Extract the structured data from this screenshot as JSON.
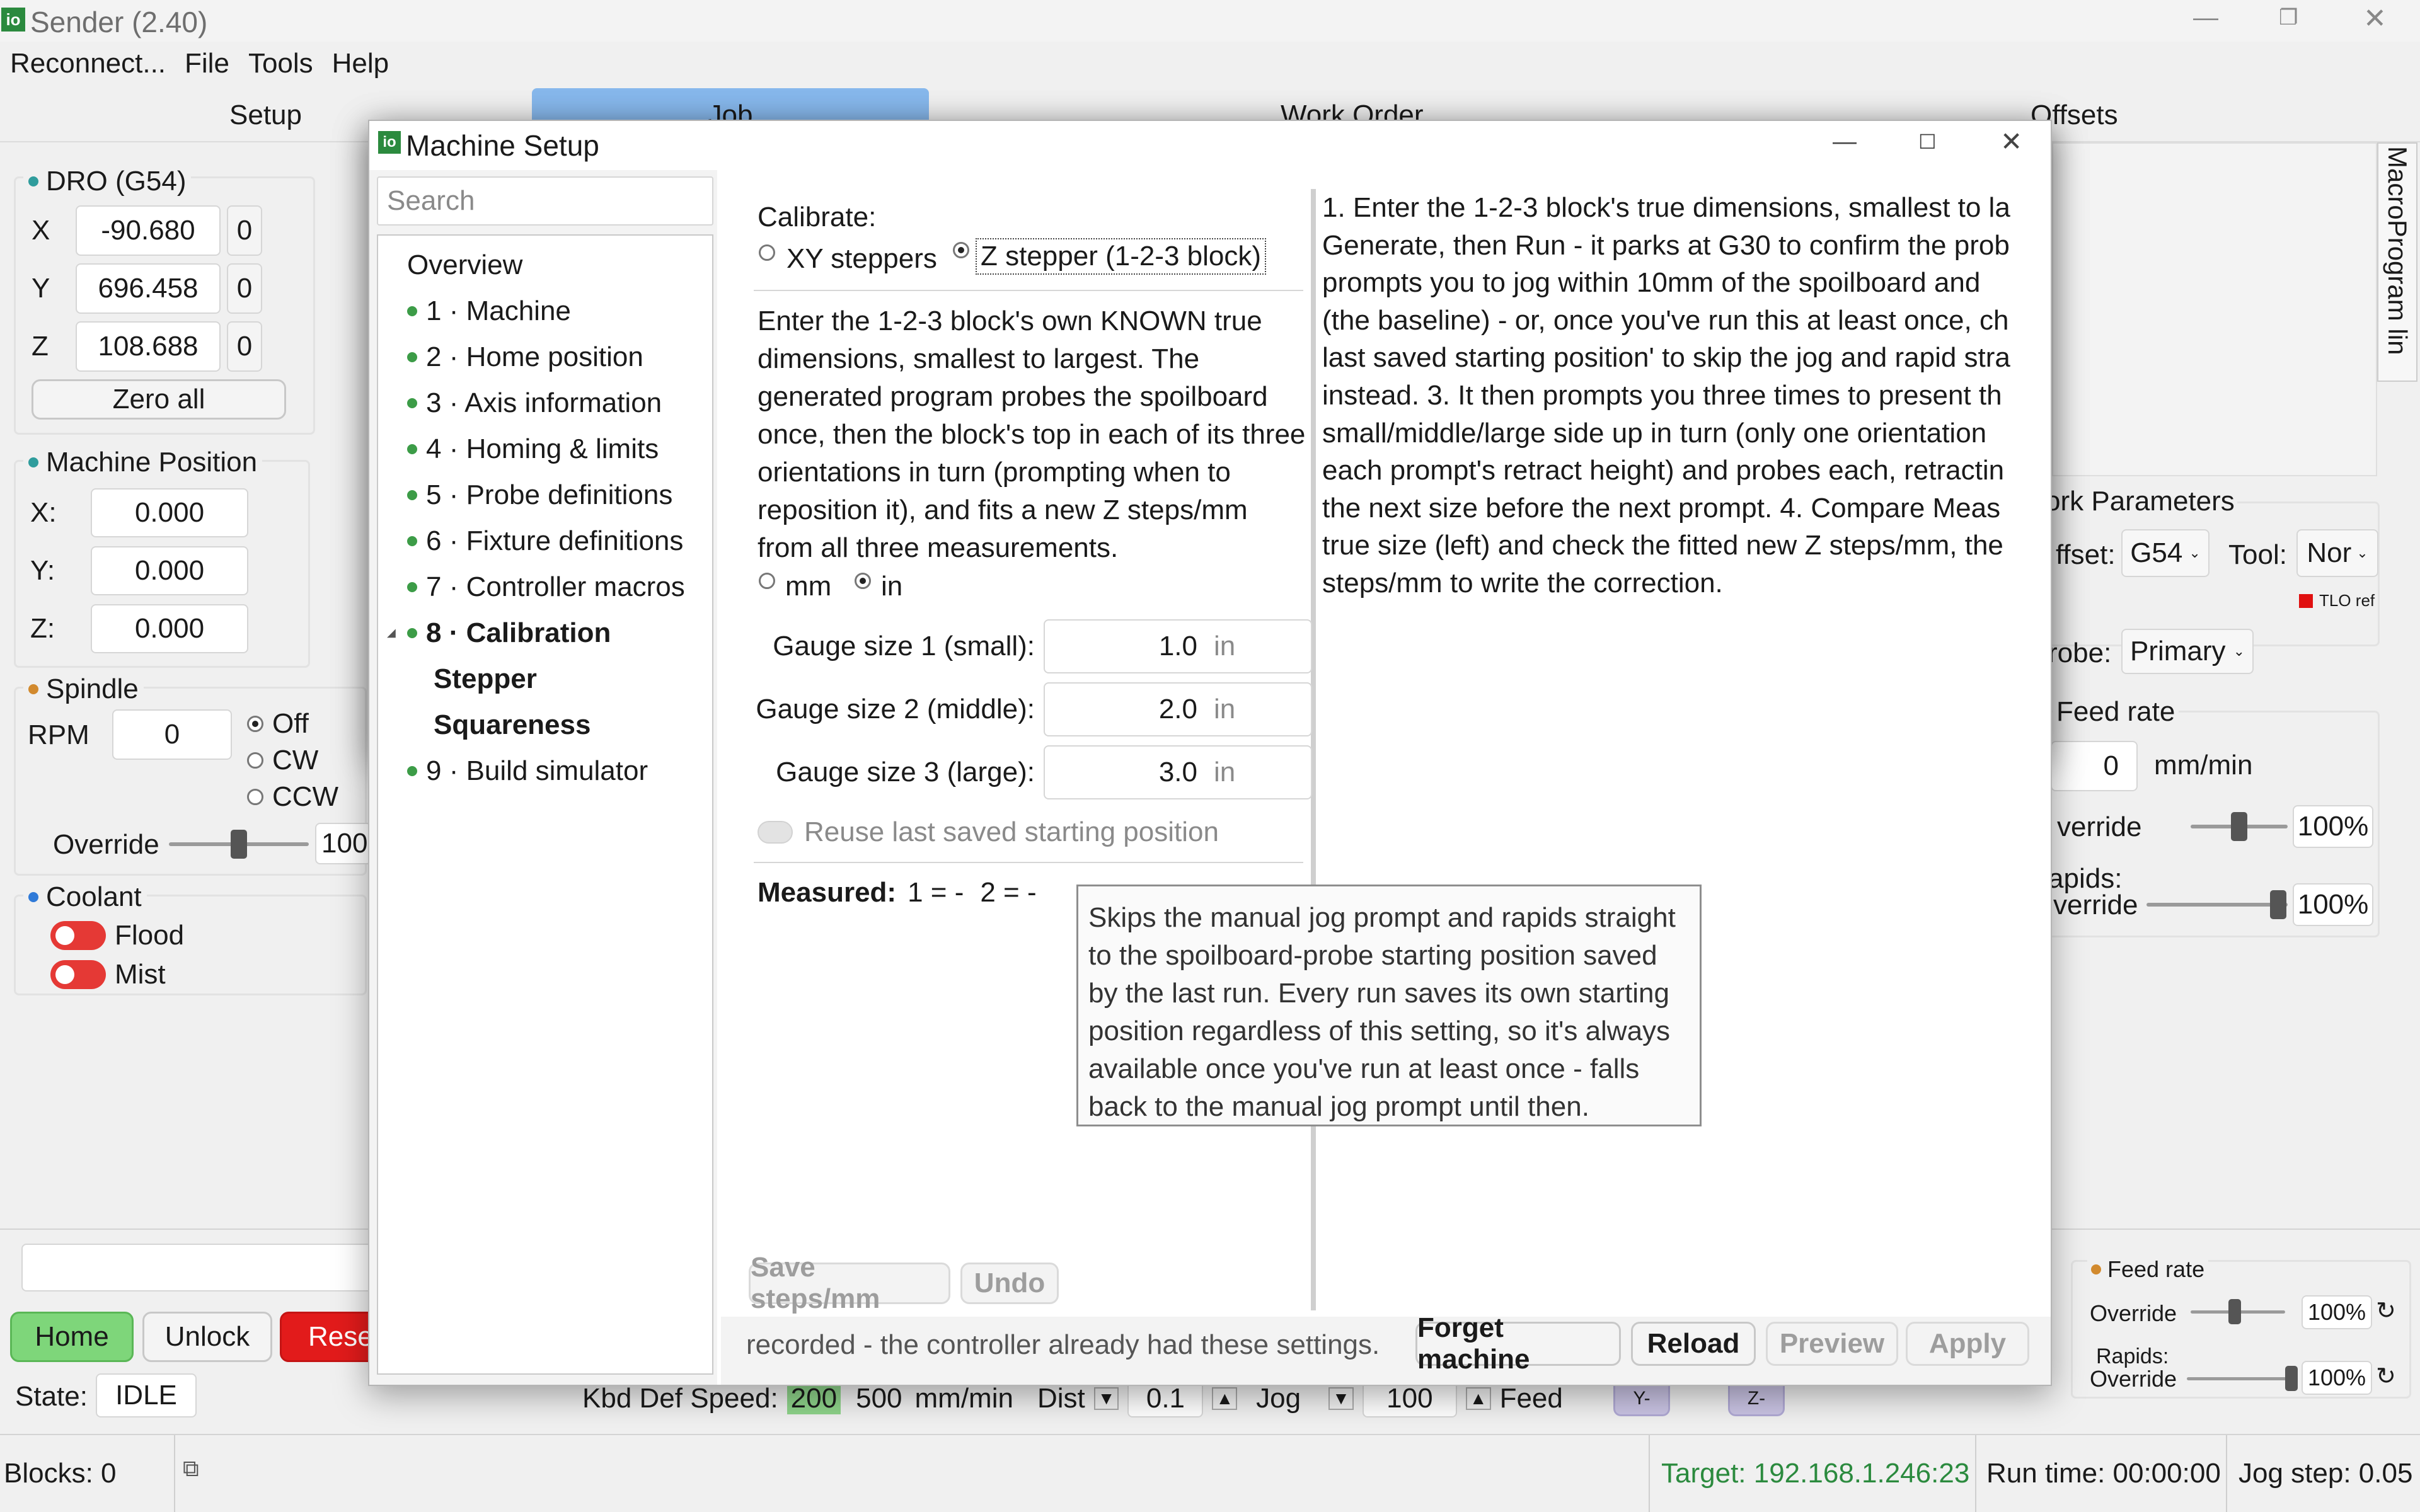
{
  "app": {
    "title": "Sender (2.40)",
    "menu": [
      "Reconnect...",
      "File",
      "Tools",
      "Help"
    ]
  },
  "main_tabs": [
    "Setup",
    "Job",
    "Work Order",
    "Offsets"
  ],
  "side_tab": "MacroProgram lin",
  "dro": {
    "title": "DRO (G54)",
    "axes": [
      {
        "label": "X",
        "value": "-90.680",
        "zero": "0"
      },
      {
        "label": "Y",
        "value": "696.458",
        "zero": "0"
      },
      {
        "label": "Z",
        "value": "108.688",
        "zero": "0"
      }
    ],
    "zero_all": "Zero all"
  },
  "machine_position": {
    "title": "Machine Position",
    "axes": [
      {
        "label": "X:",
        "value": "0.000"
      },
      {
        "label": "Y:",
        "value": "0.000"
      },
      {
        "label": "Z:",
        "value": "0.000"
      }
    ]
  },
  "spindle": {
    "title": "Spindle",
    "rpm_label": "RPM",
    "rpm_value": "0",
    "options": [
      "Off",
      "CW",
      "CCW"
    ],
    "selected": "Off",
    "override_label": "Override",
    "override_value": "100",
    "override_fraction": 0.5
  },
  "coolant": {
    "title": "Coolant",
    "items": [
      "Flood",
      "Mist"
    ]
  },
  "bottom_buttons": {
    "home": "Home",
    "unlock": "Unlock",
    "reset": "Rese"
  },
  "state": {
    "label": "State:",
    "value": "IDLE"
  },
  "kbd": {
    "label": "Kbd Def Speed:",
    "speed1": "200",
    "speed2": "500",
    "unit": "mm/min",
    "dist_label": "Dist",
    "dist_value": "0.1",
    "jog_label": "Jog",
    "jog_value": "100",
    "feed_label": "Feed"
  },
  "jog_buttons": {
    "y_minus": "Y-",
    "z_minus": "Z-"
  },
  "status_bar": {
    "blocks": "Blocks: 0",
    "target": "Target: 192.168.1.246:23",
    "runtime": "Run time: 00:00:00",
    "jogstep": "Jog step: 0.05"
  },
  "right_panel": {
    "work_params": "ork Parameters",
    "offset_label": "ffset:",
    "offset_value": "G54",
    "tool_label": "Tool:",
    "tool_value": "Nor",
    "tlo_ref": "TLO ref",
    "probe_label": "robe:",
    "probe_value": "Primary",
    "feed_rate_title": "Feed rate",
    "feed_value": "0",
    "feed_unit": "mm/min",
    "override_label": "verride",
    "override_value": "100%",
    "override_fraction": 0.5,
    "rapids_label_1": "apids:",
    "rapids_label_2": "verride",
    "rapids_value": "100%",
    "rapids_fraction": 1.0,
    "bottom_feed_title": "Feed rate",
    "bottom_override_label": "Override",
    "bottom_override_value": "100%",
    "bottom_rapids_label_1": "Rapids:",
    "bottom_rapids_label_2": "Override",
    "bottom_rapids_value": "100%"
  },
  "dialog": {
    "title": "Machine Setup",
    "search_placeholder": "Search",
    "tree": [
      {
        "label": "Overview",
        "dot": false,
        "bold": false,
        "expander": false,
        "indent": false
      },
      {
        "label": "1 · Machine",
        "dot": true,
        "bold": false,
        "expander": false,
        "indent": false
      },
      {
        "label": "2 · Home position",
        "dot": true,
        "bold": false,
        "expander": false,
        "indent": false
      },
      {
        "label": "3 · Axis information",
        "dot": true,
        "bold": false,
        "expander": false,
        "indent": false
      },
      {
        "label": "4 · Homing & limits",
        "dot": true,
        "bold": false,
        "expander": false,
        "indent": false
      },
      {
        "label": "5 · Probe definitions",
        "dot": true,
        "bold": false,
        "expander": false,
        "indent": false
      },
      {
        "label": "6 · Fixture definitions",
        "dot": true,
        "bold": false,
        "expander": false,
        "indent": false
      },
      {
        "label": "7 · Controller macros",
        "dot": true,
        "bold": false,
        "expander": false,
        "indent": false
      },
      {
        "label": "8 · Calibration",
        "dot": true,
        "bold": true,
        "expander": true,
        "indent": false
      },
      {
        "label": "Stepper",
        "dot": false,
        "bold": true,
        "expander": false,
        "indent": true
      },
      {
        "label": "Squareness",
        "dot": false,
        "bold": true,
        "expander": false,
        "indent": true
      },
      {
        "label": "9 · Build simulator",
        "dot": true,
        "bold": false,
        "expander": false,
        "indent": false
      }
    ],
    "calibrate_label": "Calibrate:",
    "calibrate_options": [
      "XY steppers",
      "Z stepper (1-2-3 block)"
    ],
    "calibrate_selected": "Z stepper (1-2-3 block)",
    "description": "Enter the 1-2-3 block's own KNOWN true dimensions, smallest to largest. The generated program probes the spoilboard once, then the block's top in each of its three orientations in turn (prompting when to reposition it), and fits a new Z steps/mm from all three measurements.",
    "unit_options": [
      "mm",
      "in"
    ],
    "unit_selected": "in",
    "gauges": [
      {
        "label": "Gauge size 1 (small):",
        "value": "1.0",
        "unit": "in"
      },
      {
        "label": "Gauge size 2 (middle):",
        "value": "2.0",
        "unit": "in"
      },
      {
        "label": "Gauge size 3 (large):",
        "value": "3.0",
        "unit": "in"
      }
    ],
    "reuse_label": "Reuse last saved starting position",
    "measured_label": "Measured:",
    "measured_1": "1 = -",
    "measured_2": "2 = -",
    "tooltip": "Skips the manual jog prompt and rapids straight to the spoilboard-probe starting position saved by the last run. Every run saves its own starting position regardless of this setting, so it's always available once you've run at least once - falls back to the manual jog prompt until then.",
    "instructions_lines": [
      "1. Enter the 1-2-3 block's true dimensions, smallest to la",
      "Generate, then Run - it parks at G30 to confirm the prob",
      "prompts you to jog within 10mm of the spoilboard and",
      "(the baseline) - or, once you've run this at least once, ch",
      "last saved starting position' to skip the jog and rapid stra",
      "instead.  3. It then prompts you three times to present th",
      "small/middle/large side up in turn (only one orientation",
      "each prompt's retract height) and probes each, retractin",
      "the next size before the next prompt.  4. Compare Meas",
      "true size (left) and check the fitted new Z steps/mm, the",
      "steps/mm to write the correction."
    ],
    "save_steps": "Save steps/mm",
    "undo": "Undo",
    "footer_text": "recorded - the controller already had these settings.",
    "forget_machine": "Forget machine",
    "reload": "Reload",
    "preview": "Preview",
    "apply": "Apply"
  }
}
